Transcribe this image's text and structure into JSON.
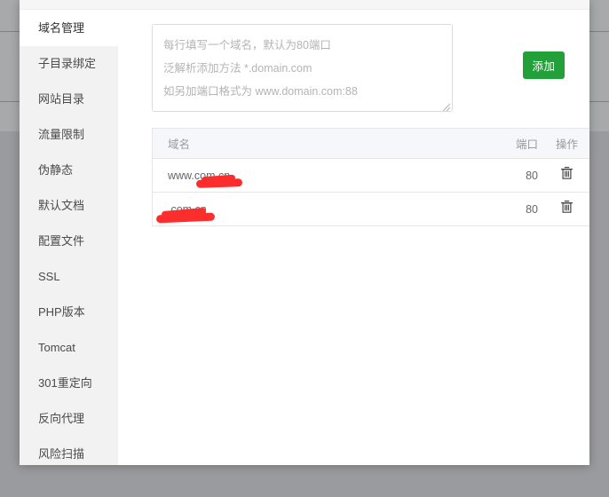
{
  "window": {
    "title": "域名管理",
    "accent_color": "#23a03a",
    "redaction_color": "#fc2d2d"
  },
  "sidebar": {
    "items": [
      {
        "label": "域名管理",
        "name": "domain-management",
        "active": true
      },
      {
        "label": "子目录绑定",
        "name": "subdirectory-binding",
        "active": false
      },
      {
        "label": "网站目录",
        "name": "website-directory",
        "active": false
      },
      {
        "label": "流量限制",
        "name": "traffic-limit",
        "active": false
      },
      {
        "label": "伪静态",
        "name": "rewrite",
        "active": false
      },
      {
        "label": "默认文档",
        "name": "default-document",
        "active": false
      },
      {
        "label": "配置文件",
        "name": "config-file",
        "active": false
      },
      {
        "label": "SSL",
        "name": "ssl",
        "active": false
      },
      {
        "label": "PHP版本",
        "name": "php-version",
        "active": false
      },
      {
        "label": "Tomcat",
        "name": "tomcat",
        "active": false
      },
      {
        "label": "301重定向",
        "name": "redirect-301",
        "active": false
      },
      {
        "label": "反向代理",
        "name": "reverse-proxy",
        "active": false
      },
      {
        "label": "风险扫描",
        "name": "risk-scan",
        "active": false
      }
    ]
  },
  "add_form": {
    "textarea_value": "",
    "textarea_placeholder": "每行填写一个域名，默认为80端口\n泛解析添加方法 *.domain.com\n如另加端口格式为 www.domain.com:88",
    "add_button_label": "添加"
  },
  "table": {
    "columns": {
      "domain": "域名",
      "port": "端口",
      "operation": "操作"
    },
    "rows": [
      {
        "domain_prefix": "www.",
        "domain_redacted": true,
        "domain_suffix": "com.cn",
        "port": "80",
        "delete_icon": "trash-icon"
      },
      {
        "domain_prefix": "",
        "domain_redacted": true,
        "domain_suffix": ".com.cn",
        "port": "80",
        "delete_icon": "trash-icon"
      }
    ]
  }
}
